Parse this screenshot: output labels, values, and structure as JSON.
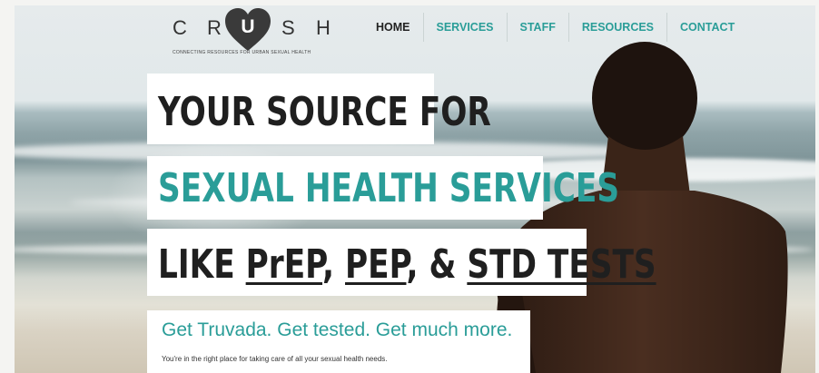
{
  "header": {
    "logo": {
      "letters": [
        "C",
        "R",
        "U",
        "S",
        "H"
      ],
      "tagline": "CONNECTING RESOURCES FOR URBAN SEXUAL HEALTH"
    },
    "nav": [
      {
        "label": "HOME",
        "active": true
      },
      {
        "label": "SERVICES",
        "active": false
      },
      {
        "label": "STAFF",
        "active": false
      },
      {
        "label": "RESOURCES",
        "active": false
      },
      {
        "label": "CONTACT",
        "active": false
      }
    ]
  },
  "hero": {
    "line1": "YOUR SOURCE FOR",
    "line2": "SEXUAL HEALTH SERVICES",
    "line3": {
      "prefix": "LIKE ",
      "link1": "PrEP",
      "sep1": ", ",
      "link2": "PEP",
      "sep2": ", & ",
      "link3": "STD TESTS"
    },
    "cta_title": "Get Truvada. Get tested. Get much more.",
    "cta_sub": "You're in the right place for taking care of all your sexual health needs."
  },
  "colors": {
    "accent": "#2a9d98",
    "text_dark": "#1f1f1f",
    "logo_heart": "#3a3a3a"
  }
}
